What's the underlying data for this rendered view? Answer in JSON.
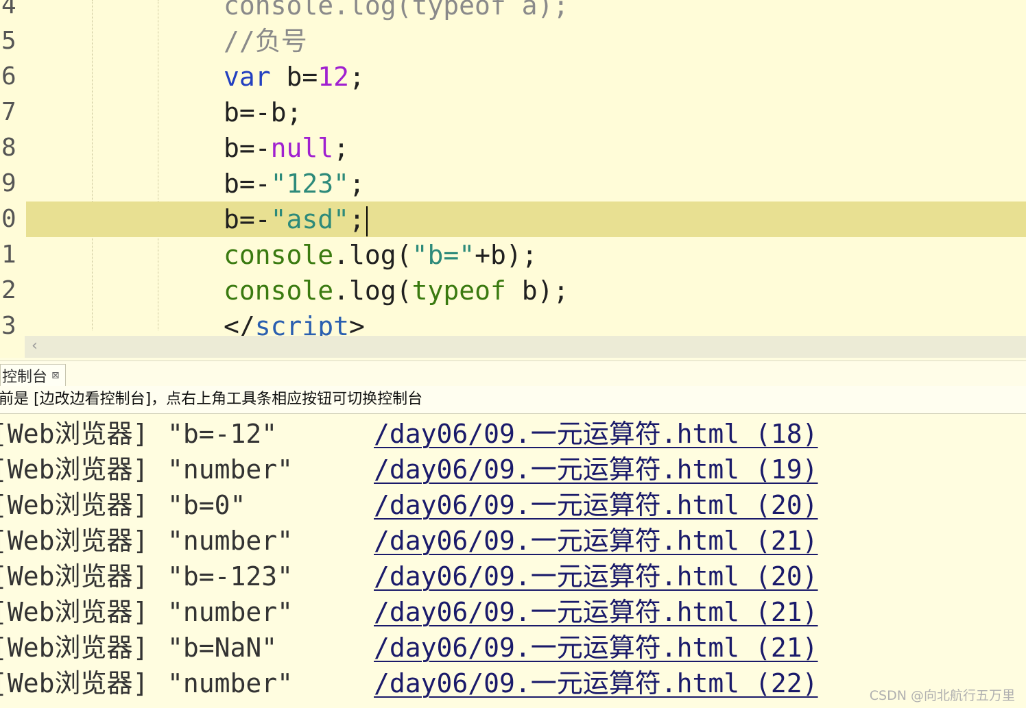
{
  "editor": {
    "lines": [
      {
        "num": "4",
        "tokens": [
          {
            "t": "console.log(typeof a);",
            "c": "t-comment"
          }
        ]
      },
      {
        "num": "5",
        "tokens": [
          {
            "t": "//负号",
            "c": "t-comment"
          }
        ]
      },
      {
        "num": "6",
        "tokens": [
          {
            "t": "var",
            "c": "t-kw"
          },
          {
            "t": " b=",
            "c": "t-punct"
          },
          {
            "t": "12",
            "c": "t-num"
          },
          {
            "t": ";",
            "c": "t-punct"
          }
        ]
      },
      {
        "num": "7",
        "tokens": [
          {
            "t": "b=-b;",
            "c": "t-punct"
          }
        ]
      },
      {
        "num": "8",
        "tokens": [
          {
            "t": "b=-",
            "c": "t-punct"
          },
          {
            "t": "null",
            "c": "t-null"
          },
          {
            "t": ";",
            "c": "t-punct"
          }
        ]
      },
      {
        "num": "9",
        "tokens": [
          {
            "t": "b=-",
            "c": "t-punct"
          },
          {
            "t": "\"123\"",
            "c": "t-str"
          },
          {
            "t": ";",
            "c": "t-punct"
          }
        ]
      },
      {
        "num": "0",
        "current": true,
        "tokens": [
          {
            "t": "b=-",
            "c": "t-punct"
          },
          {
            "t": "\"asd\"",
            "c": "t-str"
          },
          {
            "t": ";",
            "c": "t-punct"
          }
        ]
      },
      {
        "num": "1",
        "tokens": [
          {
            "t": "console",
            "c": "t-obj"
          },
          {
            "t": ".",
            "c": "t-punct"
          },
          {
            "t": "log",
            "c": "t-fn"
          },
          {
            "t": "(",
            "c": "t-punct"
          },
          {
            "t": "\"b=\"",
            "c": "t-str"
          },
          {
            "t": "+b);",
            "c": "t-punct"
          }
        ]
      },
      {
        "num": "2",
        "tokens": [
          {
            "t": "console",
            "c": "t-obj"
          },
          {
            "t": ".",
            "c": "t-punct"
          },
          {
            "t": "log",
            "c": "t-fn"
          },
          {
            "t": "(",
            "c": "t-punct"
          },
          {
            "t": "typeof",
            "c": "t-obj"
          },
          {
            "t": " b);",
            "c": "t-punct"
          }
        ]
      },
      {
        "num": "3",
        "tokens": [
          {
            "t": "</",
            "c": "t-punct"
          },
          {
            "t": "script",
            "c": "t-tag"
          },
          {
            "t": ">",
            "c": "t-punct"
          }
        ]
      }
    ],
    "scroll_arrow": "‹"
  },
  "console_panel": {
    "tab_label": "控制台",
    "tab_close": "⊠",
    "info_text": "前是 [边改边看控制台]，点右上角工具条相应按钮可切换控制台",
    "rows": [
      {
        "source": "[Web浏览器]",
        "message": "\"b=-12\"",
        "link": "/day06/09.一元运算符.html (18)"
      },
      {
        "source": "[Web浏览器]",
        "message": "\"number\"",
        "link": "/day06/09.一元运算符.html (19)"
      },
      {
        "source": "[Web浏览器]",
        "message": "\"b=0\"",
        "link": "/day06/09.一元运算符.html (20)"
      },
      {
        "source": "[Web浏览器]",
        "message": "\"number\"",
        "link": "/day06/09.一元运算符.html (21)"
      },
      {
        "source": "[Web浏览器]",
        "message": "\"b=-123\"",
        "link": "/day06/09.一元运算符.html (20)"
      },
      {
        "source": "[Web浏览器]",
        "message": "\"number\"",
        "link": "/day06/09.一元运算符.html (21)"
      },
      {
        "source": "[Web浏览器]",
        "message": "\"b=NaN\"",
        "link": "/day06/09.一元运算符.html (21)"
      },
      {
        "source": "[Web浏览器]",
        "message": "\"number\"",
        "link": "/day06/09.一元运算符.html (22)"
      }
    ]
  },
  "watermark": "CSDN @向北航行五万里"
}
